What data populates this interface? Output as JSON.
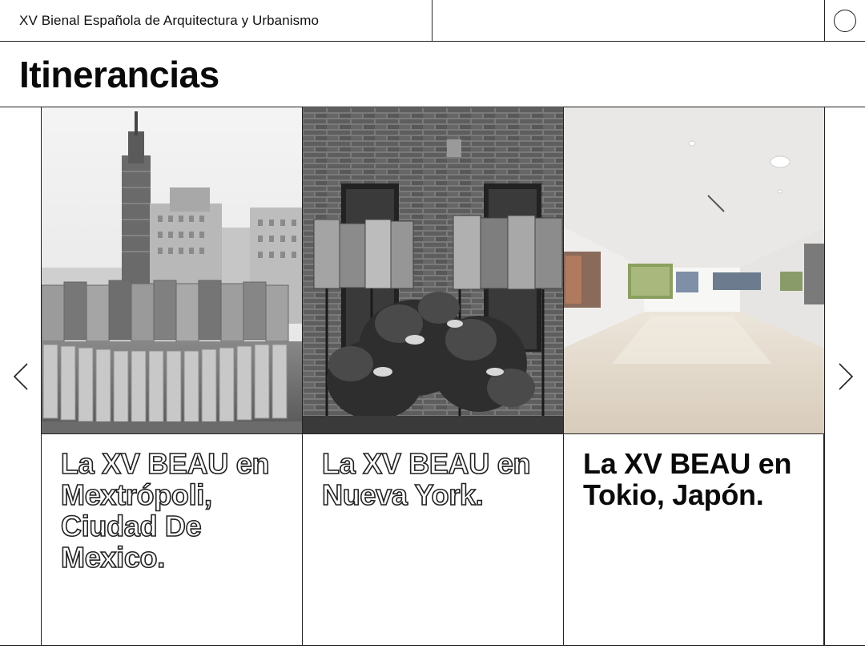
{
  "header": {
    "site_title": "XV Bienal Española de Arquitectura y Urbanismo",
    "menu_icon": "circle-menu-icon"
  },
  "page": {
    "title": "Itinerancias"
  },
  "carousel": {
    "prev_icon": "chevron-left-icon",
    "next_icon": "chevron-right-icon",
    "cards": [
      {
        "caption": "La XV BEAU en Mextrópoli, Ciudad De Mexico.",
        "style": "outline",
        "image": "mexico-city-exhibition-photo"
      },
      {
        "caption": "La XV BEAU en Nueva York.",
        "style": "outline",
        "image": "new-york-exhibition-photo"
      },
      {
        "caption": "La XV BEAU en Tokio, Japón.",
        "style": "solid",
        "image": "tokyo-gallery-photo"
      }
    ]
  }
}
